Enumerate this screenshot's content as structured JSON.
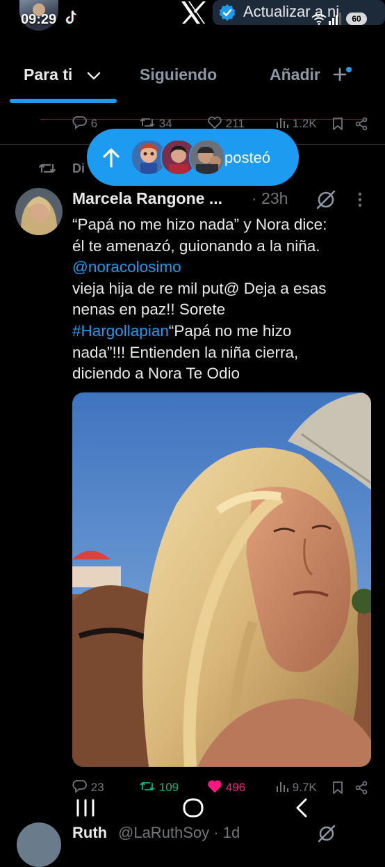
{
  "status_bar": {
    "time": "09:29",
    "battery": "60",
    "update_text": "Actualizar a ni"
  },
  "tabs": [
    {
      "label": "Para ti",
      "active": true
    },
    {
      "label": "Siguiendo",
      "active": false
    },
    {
      "label": "Añadir",
      "active": false
    }
  ],
  "prev_tweet_actions": {
    "replies": "6",
    "reposts": "34",
    "likes": "211",
    "views": "1.2K"
  },
  "posted_pill": {
    "label": "posteó"
  },
  "tweet": {
    "repost_label": "Di",
    "author_name": "Marcela Rangone ...",
    "time": "· 23h",
    "lines": [
      {
        "text": "“Papá no me hizo nada” y Nora dice:"
      },
      {
        "text": "él te amenazó, guionando a la niña."
      },
      {
        "text": "@noracolosimo",
        "link": true
      },
      {
        "text": "vieja hija de re mil put@  Deja a esas"
      },
      {
        "text": "nenas en paz!!  Sorete"
      },
      {
        "hashtag": "#Hargollapian",
        "text": "“Papá no me hizo"
      },
      {
        "text": "nada”!!!  Entienden la niña cierra,"
      },
      {
        "text": "diciendo a Nora Te Odio"
      }
    ],
    "actions": {
      "replies": "23",
      "reposts": "109",
      "likes": "496",
      "views": "9.7K"
    }
  },
  "next_tweet": {
    "author_name": "Ruth",
    "handle": "@LaRuthSoy · 1d"
  },
  "colors": {
    "accent": "#1d9bf0",
    "background": "#000000",
    "muted": "#71767b",
    "retweet_active": "#00ba7c",
    "like_active": "#f91880"
  }
}
